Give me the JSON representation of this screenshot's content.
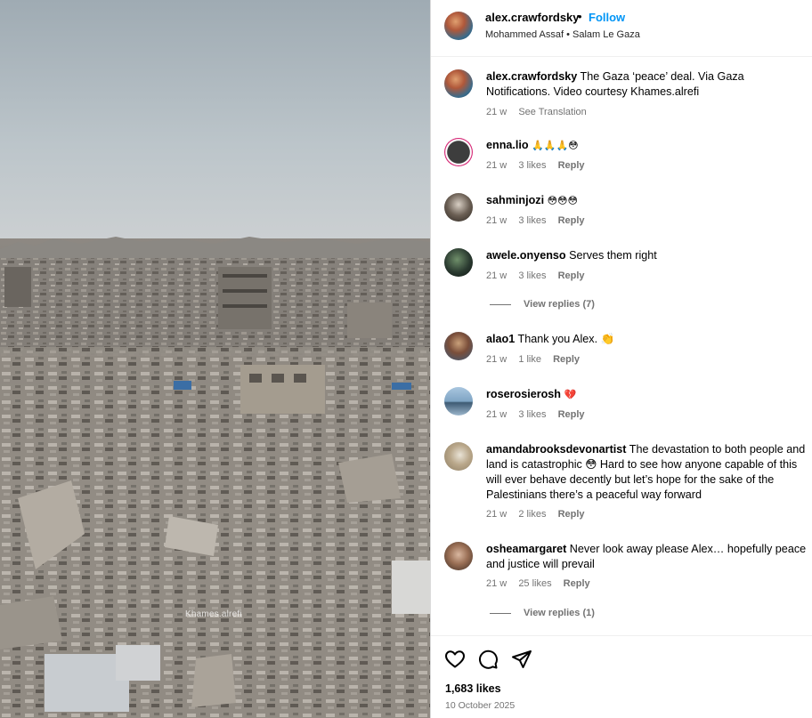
{
  "post": {
    "author": "alex.crawfordsky",
    "follow_label": "Follow",
    "separator": "•",
    "audio_line": "Mohammed Assaf • Salam Le Gaza",
    "watermark": "Khames.alrefi"
  },
  "caption": {
    "user": "alex.crawfordsky",
    "text": "The Gaza ‘peace’ deal. Via Gaza Notifications. Video courtesy Khames.alrefi",
    "time": "21 w",
    "translate_label": "See Translation"
  },
  "comments": [
    {
      "user": "enna.lio",
      "text": "🙏🙏🙏😳",
      "time": "21 w",
      "likes": "3 likes",
      "reply": "Reply"
    },
    {
      "user": "sahminjozi",
      "text": "😳😳😳",
      "time": "21 w",
      "likes": "3 likes",
      "reply": "Reply"
    },
    {
      "user": "awele.onyenso",
      "text": "Serves them right",
      "time": "21 w",
      "likes": "3 likes",
      "reply": "Reply",
      "view_replies": "View replies (7)"
    },
    {
      "user": "alao1",
      "text": "Thank you Alex. 👏",
      "time": "21 w",
      "likes": "1 like",
      "reply": "Reply"
    },
    {
      "user": "roserosierosh",
      "text": "💔",
      "time": "21 w",
      "likes": "3 likes",
      "reply": "Reply"
    },
    {
      "user": "amandabrooksdevonartist",
      "text": "The devastation to both people and land is catastrophic 😳 Hard to see how anyone capable of this will ever behave decently but let’s hope for the sake of the Palestinians there’s a peaceful way forward",
      "time": "21 w",
      "likes": "2 likes",
      "reply": "Reply"
    },
    {
      "user": "osheamargaret",
      "text": "Never look away please Alex… hopefully peace and justice will prevail",
      "time": "21 w",
      "likes": "25 likes",
      "reply": "Reply",
      "view_replies": "View replies (1)"
    }
  ],
  "footer": {
    "likes": "1,683 likes",
    "date": "10 October 2025"
  },
  "icons": [
    "heart-icon",
    "comment-icon",
    "share-icon"
  ],
  "colors": {
    "link": "#0095f6",
    "muted": "#737373",
    "border": "#dbdbdb"
  }
}
